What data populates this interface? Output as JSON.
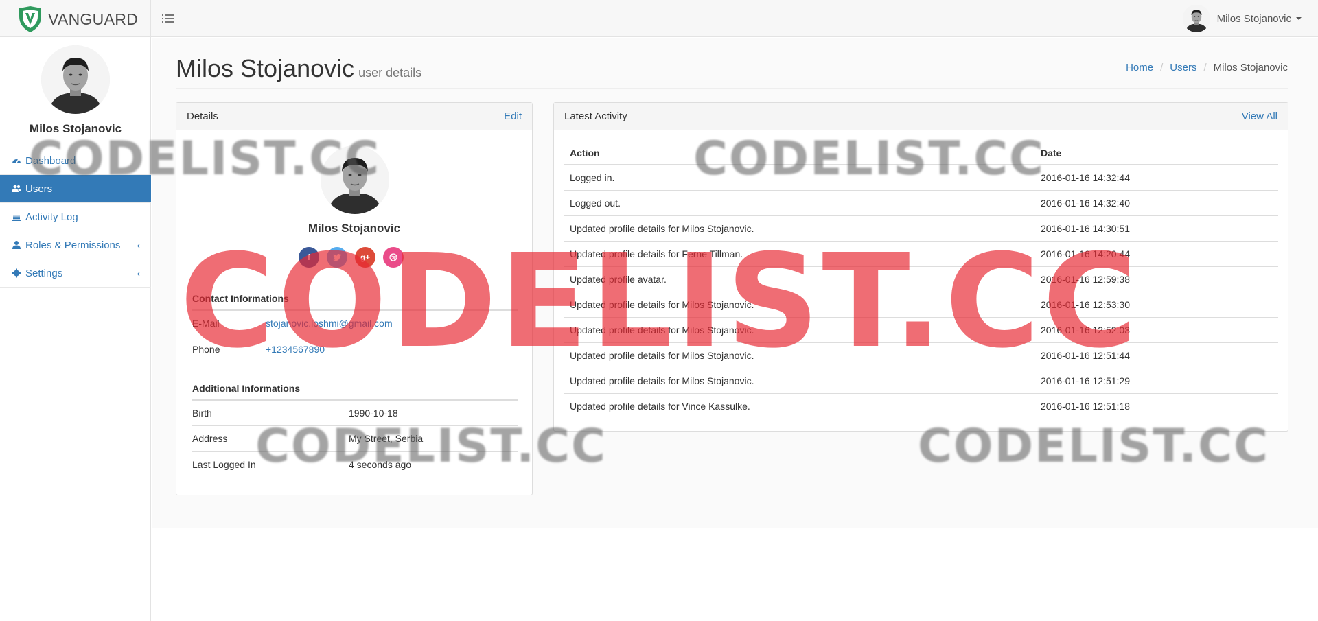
{
  "brand": {
    "name": "VANGUARD"
  },
  "navbar": {
    "user_name": "Milos Stojanovic"
  },
  "sidebar": {
    "user_name": "Milos Stojanovic",
    "items": [
      {
        "label": "Dashboard",
        "icon": "dashboard-icon"
      },
      {
        "label": "Users",
        "icon": "users-icon",
        "active": true
      },
      {
        "label": "Activity Log",
        "icon": "list-icon"
      },
      {
        "label": "Roles & Permissions",
        "icon": "user-icon"
      },
      {
        "label": "Settings",
        "icon": "gear-icon"
      }
    ]
  },
  "page": {
    "title": "Milos Stojanovic",
    "subtitle": "user details",
    "breadcrumb": [
      "Home",
      "Users",
      "Milos Stojanovic"
    ]
  },
  "details": {
    "heading": "Details",
    "edit_label": "Edit",
    "name": "Milos Stojanovic",
    "socials": [
      "facebook-icon",
      "twitter-icon",
      "google-plus-icon",
      "dribbble-icon"
    ],
    "contact_title": "Contact Informations",
    "contact": [
      {
        "label": "E-Mail",
        "value": "stojanovic.loshmi@gmail.com"
      },
      {
        "label": "Phone",
        "value": "+1234567890"
      }
    ],
    "additional_title": "Additional Informations",
    "additional": [
      {
        "label": "Birth",
        "value": "1990-10-18"
      },
      {
        "label": "Address",
        "value": "My Street, Serbia"
      },
      {
        "label": "Last Logged In",
        "value": "4 seconds ago"
      }
    ]
  },
  "activity": {
    "heading": "Latest Activity",
    "view_all_label": "View All",
    "columns": [
      "Action",
      "Date"
    ],
    "rows": [
      [
        "Logged in.",
        "2016-01-16 14:32:44"
      ],
      [
        "Logged out.",
        "2016-01-16 14:32:40"
      ],
      [
        "Updated profile details for Milos Stojanovic.",
        "2016-01-16 14:30:51"
      ],
      [
        "Updated profile details for Ferne Tillman.",
        "2016-01-16 14:20:44"
      ],
      [
        "Updated profile avatar.",
        "2016-01-16 12:59:38"
      ],
      [
        "Updated profile details for Milos Stojanovic.",
        "2016-01-16 12:53:30"
      ],
      [
        "Updated profile details for Milos Stojanovic.",
        "2016-01-16 12:52:03"
      ],
      [
        "Updated profile details for Milos Stojanovic.",
        "2016-01-16 12:51:44"
      ],
      [
        "Updated profile details for Milos Stojanovic.",
        "2016-01-16 12:51:29"
      ],
      [
        "Updated profile details for Vince Kassulke.",
        "2016-01-16 12:51:18"
      ]
    ]
  },
  "watermark": {
    "text": "CODELIST.CC"
  },
  "colors": {
    "primary": "#337ab7",
    "watermark_red": "#e82832"
  }
}
